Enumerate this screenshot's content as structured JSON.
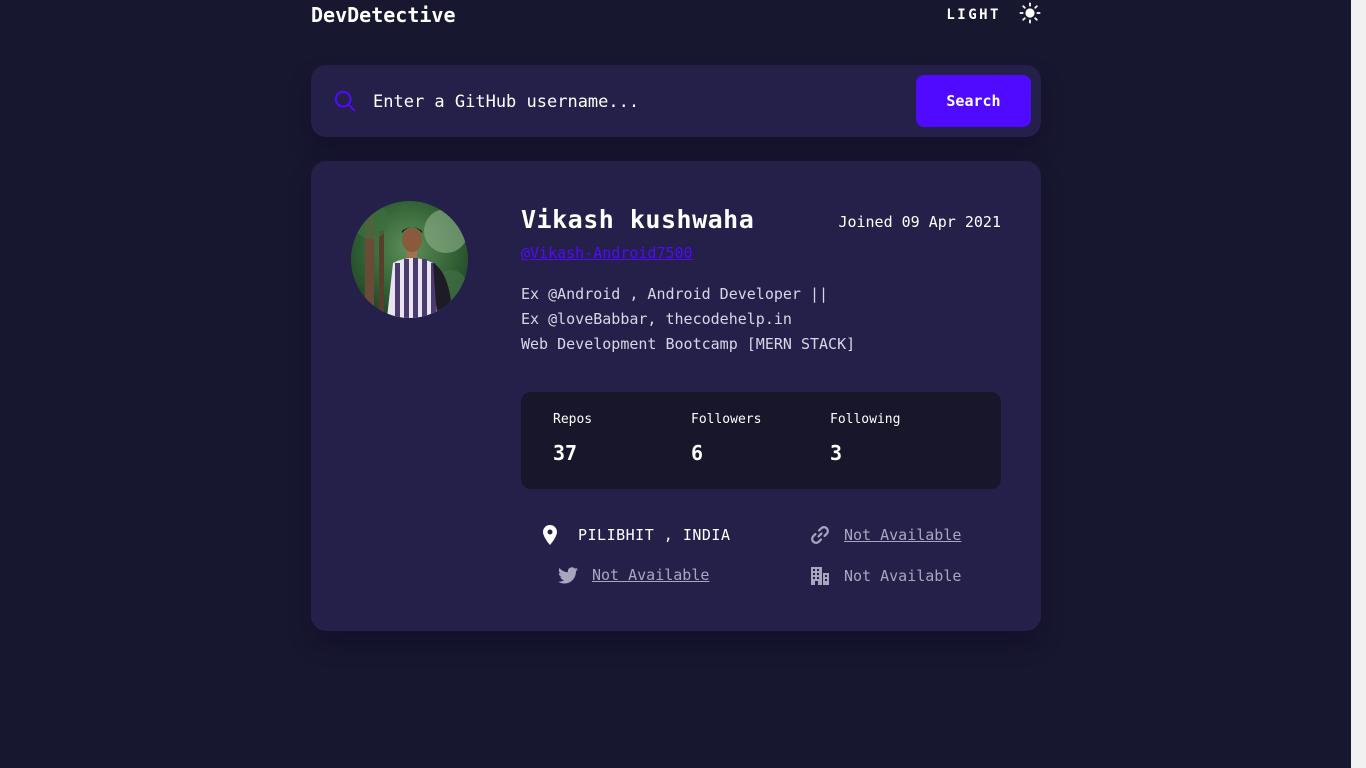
{
  "header": {
    "logo": "DevDetective",
    "mode_label": "LIGHT",
    "mode_icon": "sun-icon"
  },
  "search": {
    "placeholder": "Enter a GitHub username...",
    "value": "",
    "button_label": "Search",
    "icon": "search-icon"
  },
  "profile": {
    "name": "Vikash kushwaha",
    "joined": "Joined 09 Apr 2021",
    "username": "@Vikash-Android7500",
    "bio": [
      "Ex @Android , Android Developer ||",
      "Ex @loveBabbar, thecodehelp.in",
      "Web Development Bootcamp [MERN STACK]"
    ]
  },
  "stats": {
    "repos_label": "Repos",
    "repos": "37",
    "followers_label": "Followers",
    "followers": "6",
    "following_label": "Following",
    "following": "3"
  },
  "info": {
    "location": "PILIBHIT , INDIA",
    "website": "Not Available",
    "twitter": "Not Available",
    "company": "Not Available"
  },
  "colors": {
    "background": "#181730",
    "card": "#25204a",
    "accent": "#4f0aff",
    "stats_bg": "#17162b",
    "muted_text": "#a8a6bf"
  }
}
